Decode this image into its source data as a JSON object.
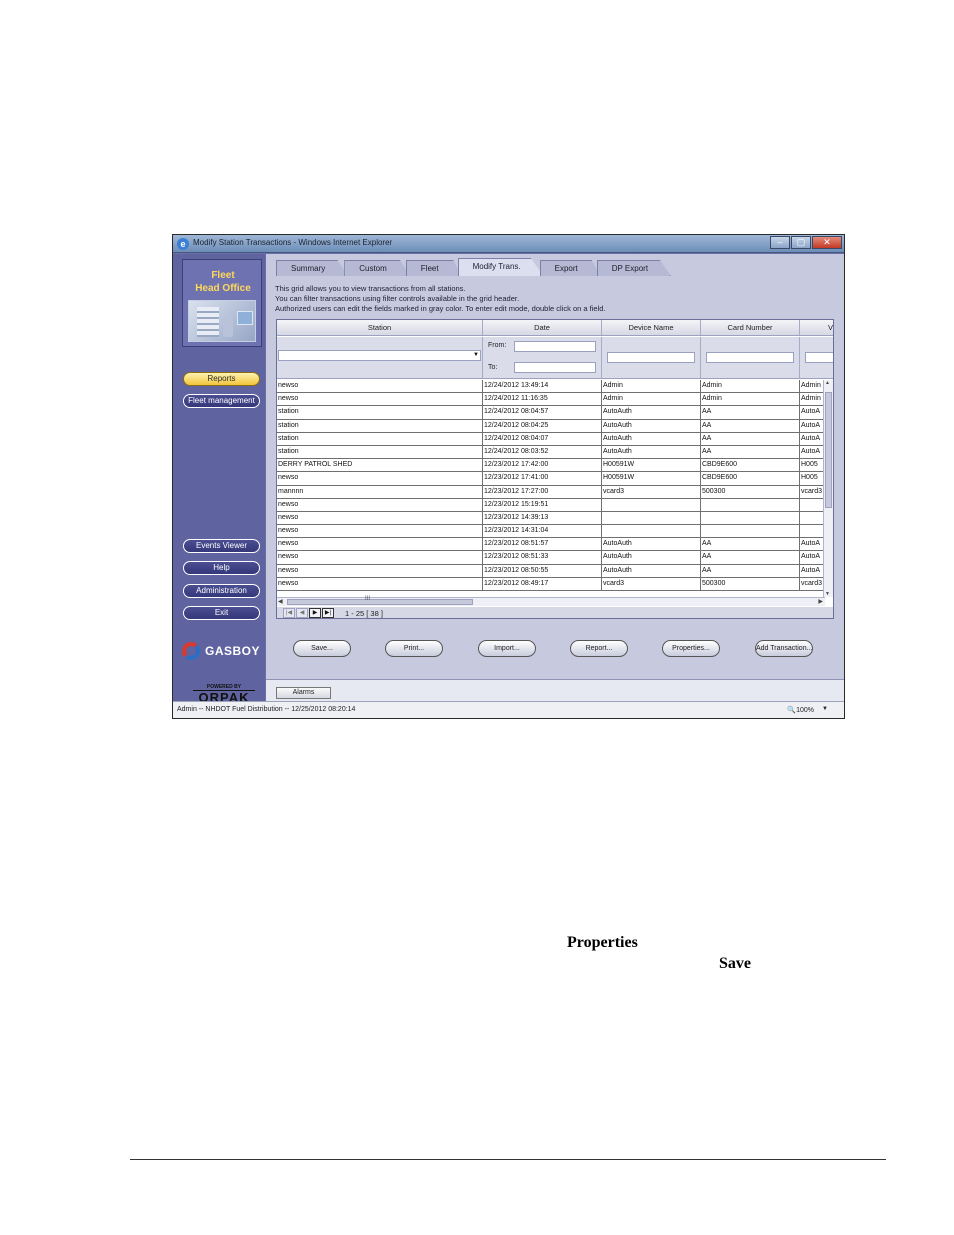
{
  "window": {
    "title": "Modify Station Transactions - Windows Internet Explorer",
    "ie_icon": "e",
    "controls": [
      "–",
      "▢",
      "✕"
    ]
  },
  "sidebar": {
    "logo_line1": "Fleet",
    "logo_line2": "Head Office",
    "nav": [
      "Reports",
      "Fleet management"
    ],
    "tools": [
      "Events Viewer",
      "Help",
      "Administration",
      "Exit"
    ],
    "brand": "GASBOY",
    "powered_by": "POWERED BY",
    "vendor": "ORPAK"
  },
  "tabs": [
    {
      "label": "Summary",
      "active": false
    },
    {
      "label": "Custom",
      "active": false
    },
    {
      "label": "Fleet",
      "active": false
    },
    {
      "label": "Modify Trans.",
      "active": true
    },
    {
      "label": "Export",
      "active": false
    },
    {
      "label": "DP Export",
      "active": false
    }
  ],
  "info": {
    "line1": "This grid allows you to view transactions from all stations.",
    "line2": "You can filter transactions using filter controls available in the grid header.",
    "line3": "Authorized users can edit the fields marked in gray color. To enter edit mode, double click on a field."
  },
  "grid": {
    "columns": [
      "Station",
      "Date",
      "Device Name",
      "Card Number",
      "V"
    ],
    "filter": {
      "from_label": "From:",
      "to_label": "To:"
    },
    "rows": [
      [
        "newso",
        "12/24/2012 13:49:14",
        "Admin",
        "Admin",
        "Admin"
      ],
      [
        "newso",
        "12/24/2012 11:16:35",
        "Admin",
        "Admin",
        "Admin"
      ],
      [
        "station",
        "12/24/2012 08:04:57",
        "AutoAuth",
        "AA",
        "AutoA"
      ],
      [
        "station",
        "12/24/2012 08:04:25",
        "AutoAuth",
        "AA",
        "AutoA"
      ],
      [
        "station",
        "12/24/2012 08:04:07",
        "AutoAuth",
        "AA",
        "AutoA"
      ],
      [
        "station",
        "12/24/2012 08:03:52",
        "AutoAuth",
        "AA",
        "AutoA"
      ],
      [
        "DERRY PATROL SHED",
        "12/23/2012 17:42:00",
        "H00591W",
        "CBD9E600",
        "H005"
      ],
      [
        "newso",
        "12/23/2012 17:41:00",
        "H00591W",
        "CBD9E600",
        "H005"
      ],
      [
        "mannnn",
        "12/23/2012 17:27:00",
        "vcard3",
        "500300",
        "vcard3"
      ],
      [
        "newso",
        "12/23/2012 15:19:51",
        "",
        "",
        ""
      ],
      [
        "newso",
        "12/23/2012 14:39:13",
        "",
        "",
        ""
      ],
      [
        "newso",
        "12/23/2012 14:31:04",
        "",
        "",
        ""
      ],
      [
        "newso",
        "12/23/2012 08:51:57",
        "AutoAuth",
        "AA",
        "AutoA"
      ],
      [
        "newso",
        "12/23/2012 08:51:33",
        "AutoAuth",
        "AA",
        "AutoA"
      ],
      [
        "newso",
        "12/23/2012 08:50:55",
        "AutoAuth",
        "AA",
        "AutoA"
      ],
      [
        "newso",
        "12/23/2012 08:49:17",
        "vcard3",
        "500300",
        "vcard3"
      ]
    ],
    "hscroll_label": "III",
    "pager": {
      "info": "1 - 25  [ 38 ]"
    }
  },
  "actions": [
    "Save...",
    "Print...",
    "Import...",
    "Report...",
    "Properties...",
    "Add Transaction..."
  ],
  "alarms_label": "Alarms",
  "statusbar": {
    "text": "Admin -- NHDOT Fuel Distribution -- 12/25/2012 08:20:14",
    "zoom": "🔍100%"
  },
  "document": {
    "properties": "Properties",
    "save": "Save"
  }
}
